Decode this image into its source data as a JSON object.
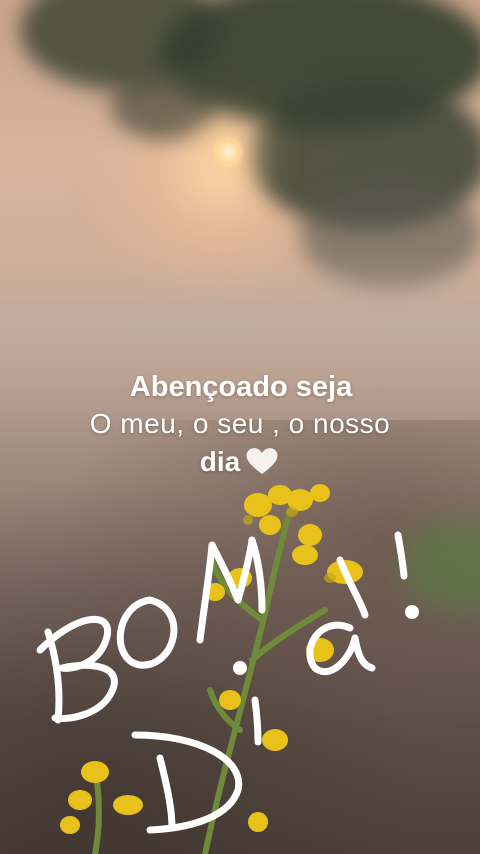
{
  "caption": {
    "line1": "Abençoado seja",
    "line2": "O meu, o seu , o nosso",
    "line3_word": "dia"
  },
  "handwritten_text": "BOM Dia!",
  "icons": {
    "heart": "white-heart-icon"
  },
  "colors": {
    "caption_text": "#ffffff",
    "handwriting": "#ffffff",
    "flowers": "#e8c21a"
  }
}
